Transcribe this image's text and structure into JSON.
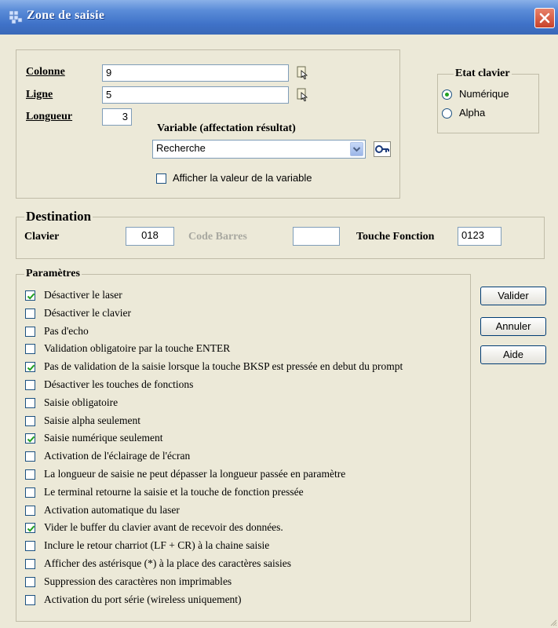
{
  "window": {
    "title": "Zone de saisie"
  },
  "position": {
    "colonne_label": "Colonne",
    "colonne_value": "9",
    "ligne_label": "Ligne",
    "ligne_value": "5",
    "longueur_label": "Longueur",
    "longueur_value": "3"
  },
  "variable": {
    "label": "Variable (affectation résultat)",
    "value": "Recherche",
    "show_value_label": "Afficher la valeur de la variable",
    "show_value_checked": false
  },
  "etat_clavier": {
    "legend": "Etat clavier",
    "options": [
      {
        "label": "Numérique",
        "selected": true
      },
      {
        "label": "Alpha",
        "selected": false
      }
    ]
  },
  "destination": {
    "legend": "Destination",
    "clavier_label": "Clavier",
    "clavier_value": "018",
    "code_barres_label": "Code Barres",
    "code_barres_value": "",
    "touche_fonction_label": "Touche Fonction",
    "touche_fonction_value": "0123"
  },
  "parametres": {
    "legend": "Paramètres",
    "items": [
      {
        "label": "Désactiver le laser",
        "checked": true
      },
      {
        "label": "Désactiver le clavier",
        "checked": false
      },
      {
        "label": "Pas d'echo",
        "checked": false
      },
      {
        "label": "Validation obligatoire par la touche ENTER",
        "checked": false
      },
      {
        "label": "Pas de validation de la saisie lorsque la touche BKSP est pressée en debut du prompt",
        "checked": true
      },
      {
        "label": "Désactiver les touches de fonctions",
        "checked": false
      },
      {
        "label": "Saisie obligatoire",
        "checked": false
      },
      {
        "label": "Saisie alpha seulement",
        "checked": false
      },
      {
        "label": "Saisie numérique seulement",
        "checked": true
      },
      {
        "label": "Activation de l'éclairage de l'écran",
        "checked": false
      },
      {
        "label": "La longueur de saisie ne peut dépasser la longueur passée en paramètre",
        "checked": false
      },
      {
        "label": "Le terminal retourne la saisie et la touche de fonction pressée",
        "checked": false
      },
      {
        "label": "Activation automatique du laser",
        "checked": false
      },
      {
        "label": "Vider le buffer du clavier avant de recevoir des données.",
        "checked": true
      },
      {
        "label": "Inclure le retour charriot (LF + CR) à la chaine saisie",
        "checked": false
      },
      {
        "label": "Afficher des astérisque (*) à la place des caractères saisies",
        "checked": false
      },
      {
        "label": "Suppression des caractères non imprimables",
        "checked": false
      },
      {
        "label": "Activation du port série (wireless uniquement)",
        "checked": false
      }
    ]
  },
  "buttons": {
    "valider": "Valider",
    "annuler": "Annuler",
    "aide": "Aide"
  }
}
